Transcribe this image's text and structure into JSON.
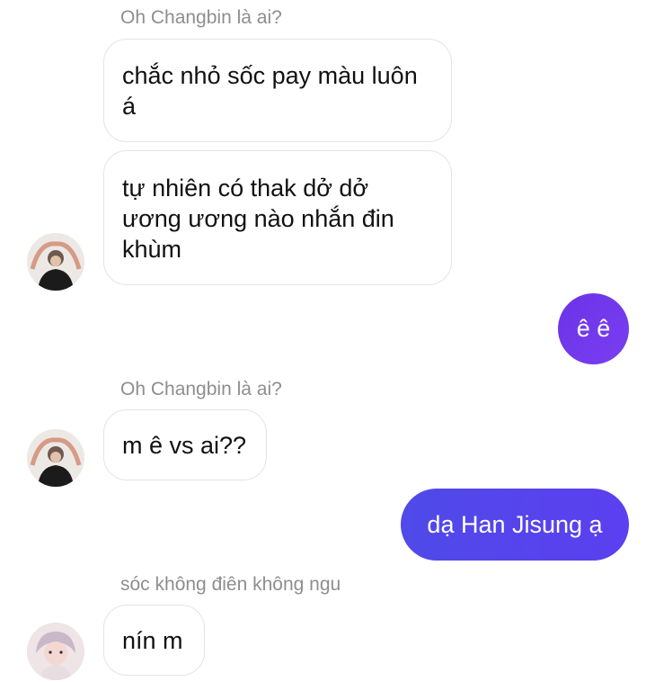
{
  "conversation": {
    "messages": [
      {
        "sender": "Oh Changbin là ai?",
        "text": "chắc nhỏ sốc pay màu luôn á"
      },
      {
        "text": "tự nhiên có thak dở dở ương ương nào nhắn đin khùm"
      },
      {
        "outgoing": true,
        "text": "ê ê"
      },
      {
        "sender": "Oh Changbin là ai?",
        "text": "m ê vs ai??"
      },
      {
        "outgoing": true,
        "text": "dạ Han Jisung ạ"
      },
      {
        "sender": "sóc không điên không ngu",
        "text": "nín m"
      }
    ]
  },
  "colors": {
    "outgoing_gradient_start": "#4f46e5",
    "outgoing_gradient_end": "#7c3aed",
    "incoming_border": "#e4e4e4",
    "sender_label": "#8e8e8e"
  },
  "icons": {
    "avatar_1": "profile-photo",
    "avatar_2": "profile-photo",
    "avatar_3": "profile-photo"
  }
}
